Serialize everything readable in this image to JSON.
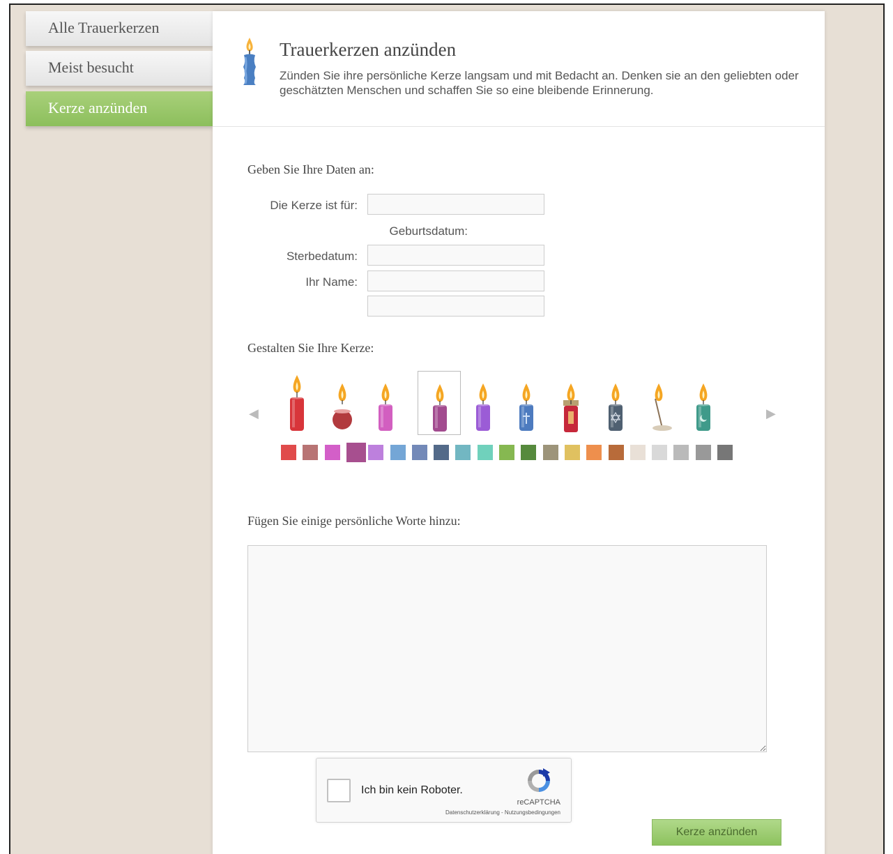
{
  "sidebar": {
    "items": [
      {
        "label": "Alle Trauerkerzen",
        "active": false
      },
      {
        "label": "Meist besucht",
        "active": false
      },
      {
        "label": "Kerze anzünden",
        "active": true
      }
    ]
  },
  "header": {
    "title": "Trauerkerzen anzünden",
    "description": "Zünden Sie ihre persönliche Kerze langsam und mit Bedacht an. Denken sie an den geliebten oder geschätzten Menschen und schaffen Sie so eine bleibende Erinnerung.",
    "icon": "candle-icon"
  },
  "form": {
    "data_title": "Geben Sie Ihre Daten an:",
    "label_for": "Die Kerze ist für:",
    "label_birth": "Geburtsdatum:",
    "label_death": "Sterbedatum:",
    "label_name": "Ihr Name:",
    "value_for": "",
    "value_death": "",
    "value_name": "",
    "value_extra": ""
  },
  "design": {
    "title": "Gestalten Sie Ihre Kerze:",
    "selected_candle_index": 3,
    "selected_color_index": 3,
    "candles": [
      {
        "name": "tall-red-candle",
        "color": "#d8353a"
      },
      {
        "name": "round-red-candle",
        "color": "#b23a3e"
      },
      {
        "name": "pink-candle",
        "color": "#d25fc0"
      },
      {
        "name": "wavy-purple-candle",
        "color": "#a24b8f"
      },
      {
        "name": "violet-candle",
        "color": "#9b5cd6"
      },
      {
        "name": "blue-cross-candle",
        "color": "#4d7bbf"
      },
      {
        "name": "grave-lantern-candle",
        "color": "#c6283a"
      },
      {
        "name": "star-of-david-candle",
        "color": "#4f6071"
      },
      {
        "name": "incense-stick",
        "color": "#8c7358"
      },
      {
        "name": "teal-crescent-candle",
        "color": "#3f9a8a"
      }
    ],
    "colors": [
      "#e04b4b",
      "#b87474",
      "#d35fc8",
      "#a74f8f",
      "#bd80dd",
      "#74a6d6",
      "#7389b8",
      "#536a89",
      "#72b7c2",
      "#70d1bc",
      "#86b851",
      "#568a3d",
      "#9d947a",
      "#e0c160",
      "#ee8f4d",
      "#b86b3a",
      "#e9e0d7",
      "#d9d9d9",
      "#bababa",
      "#999999",
      "#777777"
    ]
  },
  "message": {
    "title": "Fügen Sie einige persönliche Worte hinzu:",
    "value": ""
  },
  "captcha": {
    "label": "Ich bin kein Roboter.",
    "brand": "reCAPTCHA",
    "links": "Datenschutzerklärung - Nutzungsbedingungen"
  },
  "submit_label": "Kerze anzünden"
}
